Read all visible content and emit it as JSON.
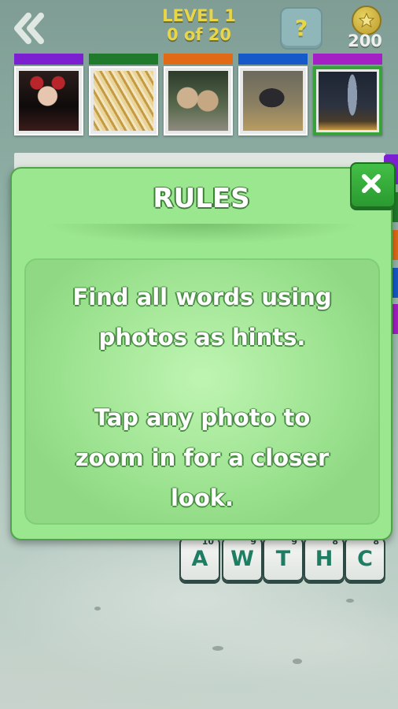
{
  "header": {
    "level_label": "LEVEL 1",
    "progress_label": "0 of 20",
    "help_symbol": "?",
    "coins": "200"
  },
  "photos": [
    {
      "name": "photo-woman",
      "bar_color": "#7b1fd1",
      "active": false
    },
    {
      "name": "photo-grain",
      "bar_color": "#1f7a2c",
      "active": false
    },
    {
      "name": "photo-cubs",
      "bar_color": "#e06a16",
      "active": false
    },
    {
      "name": "photo-bird",
      "bar_color": "#1659c9",
      "active": false
    },
    {
      "name": "photo-night",
      "bar_color": "#a41fc4",
      "active": true
    }
  ],
  "tiles": [
    {
      "letter": "A",
      "num": "10"
    },
    {
      "letter": "W",
      "num": "9"
    },
    {
      "letter": "T",
      "num": "9"
    },
    {
      "letter": "H",
      "num": "8"
    },
    {
      "letter": "C",
      "num": "8"
    }
  ],
  "modal": {
    "title": "RULES",
    "line1": "Find all words using",
    "line2": "photos as hints.",
    "line3": "Tap any photo to",
    "line4": "zoom in for a closer",
    "line5": "look."
  },
  "colors": {
    "accent_yellow": "#e8d648",
    "modal_green": "#9be78f",
    "close_green": "#2a9a30",
    "tile_letter": "#1e7e63"
  },
  "icons": {
    "back": "double-chevron-left-icon",
    "coin": "star-coin-icon",
    "close": "close-x-icon"
  }
}
